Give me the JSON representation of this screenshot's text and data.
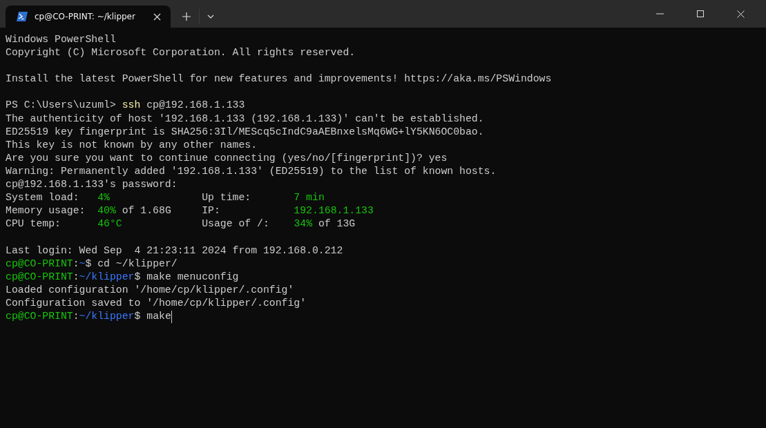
{
  "tabs": [
    {
      "title": "cp@CO-PRINT: ~/klipper",
      "selected": true
    }
  ],
  "terminal": {
    "lines": [
      {
        "kind": "text",
        "segments": [
          {
            "kind": "plain",
            "text": "Windows PowerShell"
          }
        ]
      },
      {
        "kind": "text",
        "segments": [
          {
            "kind": "plain",
            "text": "Copyright (C) Microsoft Corporation. All rights reserved."
          }
        ]
      },
      {
        "kind": "blank"
      },
      {
        "kind": "text",
        "segments": [
          {
            "kind": "plain",
            "text": "Install the latest PowerShell for new features and improvements! https://aka.ms/PSWindows"
          }
        ]
      },
      {
        "kind": "blank"
      },
      {
        "kind": "text",
        "segments": [
          {
            "kind": "plain",
            "text": "PS C:\\Users\\uzuml> "
          },
          {
            "kind": "command",
            "text": "ssh"
          },
          {
            "kind": "plain",
            "text": " cp@192.168.1.133"
          }
        ]
      },
      {
        "kind": "text",
        "segments": [
          {
            "kind": "plain",
            "text": "The authenticity of host '192.168.1.133 (192.168.1.133)' can't be established."
          }
        ]
      },
      {
        "kind": "text",
        "segments": [
          {
            "kind": "plain",
            "text": "ED25519 key fingerprint is SHA256:3Il/MEScq5cIndC9aAEBnxelsMq6WG+lY5KN6OC0bao."
          }
        ]
      },
      {
        "kind": "text",
        "segments": [
          {
            "kind": "plain",
            "text": "This key is not known by any other names."
          }
        ]
      },
      {
        "kind": "text",
        "segments": [
          {
            "kind": "plain",
            "text": "Are you sure you want to continue connecting (yes/no/[fingerprint])? yes"
          }
        ]
      },
      {
        "kind": "text",
        "segments": [
          {
            "kind": "plain",
            "text": "Warning: Permanently added '192.168.1.133' (ED25519) to the list of known hosts."
          }
        ]
      },
      {
        "kind": "text",
        "segments": [
          {
            "kind": "plain",
            "text": "cp@192.168.1.133's password:"
          }
        ]
      },
      {
        "kind": "text",
        "segments": [
          {
            "kind": "plain",
            "text": "System load:   "
          },
          {
            "kind": "ok",
            "text": "4%"
          },
          {
            "kind": "plain",
            "text": "               Up time:       "
          },
          {
            "kind": "ok",
            "text": "7 min"
          }
        ]
      },
      {
        "kind": "text",
        "segments": [
          {
            "kind": "plain",
            "text": "Memory usage:  "
          },
          {
            "kind": "ok",
            "text": "40%"
          },
          {
            "kind": "plain",
            "text": " of 1.68G     IP:            "
          },
          {
            "kind": "ok",
            "text": "192.168.1.133"
          }
        ]
      },
      {
        "kind": "text",
        "segments": [
          {
            "kind": "plain",
            "text": "CPU temp:      "
          },
          {
            "kind": "ok",
            "text": "46°C"
          },
          {
            "kind": "plain",
            "text": "             Usage of /:    "
          },
          {
            "kind": "ok",
            "text": "34%"
          },
          {
            "kind": "plain",
            "text": " of 13G"
          }
        ]
      },
      {
        "kind": "blank"
      },
      {
        "kind": "text",
        "segments": [
          {
            "kind": "plain",
            "text": "Last login: Wed Sep  4 21:23:11 2024 from 192.168.0.212"
          }
        ]
      },
      {
        "kind": "text",
        "segments": [
          {
            "kind": "ok",
            "text": "cp@CO-PRINT"
          },
          {
            "kind": "plain",
            "text": ":"
          },
          {
            "kind": "path",
            "text": "~"
          },
          {
            "kind": "plain",
            "text": "$ cd ~/klipper/"
          }
        ]
      },
      {
        "kind": "text",
        "segments": [
          {
            "kind": "ok",
            "text": "cp@CO-PRINT"
          },
          {
            "kind": "plain",
            "text": ":"
          },
          {
            "kind": "path",
            "text": "~/klipper"
          },
          {
            "kind": "plain",
            "text": "$ make menuconfig"
          }
        ]
      },
      {
        "kind": "text",
        "segments": [
          {
            "kind": "plain",
            "text": "Loaded configuration '/home/cp/klipper/.config'"
          }
        ]
      },
      {
        "kind": "text",
        "segments": [
          {
            "kind": "plain",
            "text": "Configuration saved to '/home/cp/klipper/.config'"
          }
        ]
      },
      {
        "kind": "text",
        "cursor": true,
        "segments": [
          {
            "kind": "ok",
            "text": "cp@CO-PRINT"
          },
          {
            "kind": "plain",
            "text": ":"
          },
          {
            "kind": "path",
            "text": "~/klipper"
          },
          {
            "kind": "plain",
            "text": "$ make"
          }
        ]
      }
    ]
  }
}
